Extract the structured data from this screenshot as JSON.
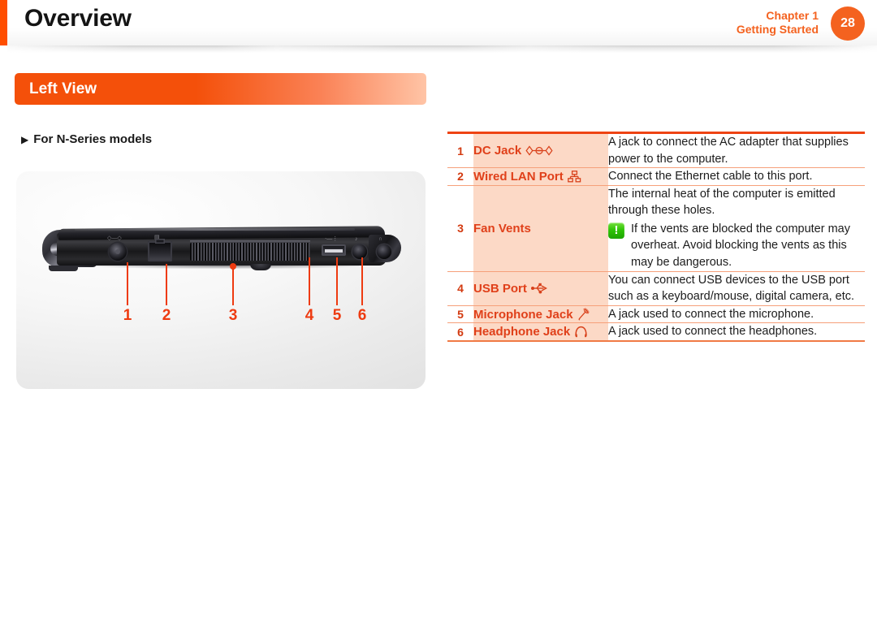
{
  "header": {
    "title": "Overview",
    "chapter_label": "Chapter 1",
    "chapter_name": "Getting Started",
    "page_number": "28",
    "accent_color": "#ff4e00",
    "chapter_text_color": "#f4621f"
  },
  "section": {
    "banner_title": "Left View",
    "banner_gradient_from": "#f4500a",
    "banner_gradient_to": "#ffc4a6",
    "subheading": "For N-Series models",
    "subheading_bullet": "▶"
  },
  "photo": {
    "caption_numbers": [
      "1",
      "2",
      "3",
      "4",
      "5",
      "6"
    ],
    "callout_color": "#ee3b11",
    "description": "Left side profile of an N-Series notebook computer showing the DC jack, wired LAN port, fan vents, USB port, microphone jack and headphone jack"
  },
  "table": {
    "border_top_color": "#ee4313",
    "row_divider_color": "#f6a07a",
    "label_bg_color": "#fcd9c6",
    "label_text_color": "#e0401a",
    "number_text_color": "#d33a10",
    "rows": [
      {
        "num": "1",
        "label": "DC Jack",
        "icon": "dc-jack-icon",
        "desc": "A jack to connect the AC adapter that supplies power to the computer."
      },
      {
        "num": "2",
        "label": "Wired LAN Port",
        "icon": "wired-lan-icon",
        "desc": "Connect the Ethernet cable to this port."
      },
      {
        "num": "3",
        "label": "Fan Vents",
        "icon": "",
        "desc": "The internal heat of the computer is emitted through these holes.",
        "note_icon": "warning-icon",
        "note_icon_color": "#2fc406",
        "note": "If the vents are blocked the computer may overheat. Avoid blocking the vents as this may be dangerous."
      },
      {
        "num": "4",
        "label": "USB Port",
        "icon": "usb-icon",
        "desc": "You can connect USB devices to the USB port such as a keyboard/mouse, digital camera, etc."
      },
      {
        "num": "5",
        "label": "Microphone Jack",
        "icon": "microphone-icon",
        "desc": "A jack used to connect the microphone."
      },
      {
        "num": "6",
        "label": "Headphone Jack",
        "icon": "headphone-icon",
        "desc": "A jack used to connect the headphones."
      }
    ]
  }
}
